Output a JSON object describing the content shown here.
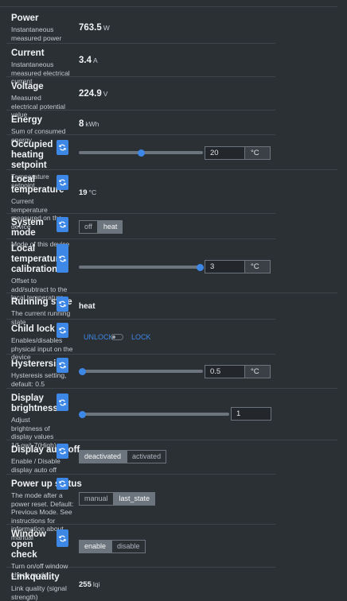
{
  "colors": {
    "background": "#2b3035",
    "accent": "#3d87e6",
    "border": "#3e444a"
  },
  "refresh_icon": "refresh-icon",
  "power": {
    "name": "Power",
    "desc": "Instantaneous measured power",
    "value": "763.5",
    "unit": "W"
  },
  "current": {
    "name": "Current",
    "desc": "Instantaneous measured electrical current",
    "value": "3.4",
    "unit": "A"
  },
  "voltage": {
    "name": "Voltage",
    "desc": "Measured electrical potential value",
    "value": "224.9",
    "unit": "V"
  },
  "energy": {
    "name": "Energy",
    "desc": "Sum of consumed energy",
    "value": "8",
    "unit": "kWh"
  },
  "setpoint": {
    "name": "Occupied heating setpoint",
    "desc": "Temperature setpoint",
    "value": "20",
    "unit": "°C",
    "slider_fraction": 0.5
  },
  "local_temp": {
    "name": "Local temperature",
    "desc": "Current temperature measured on the device",
    "value": "19",
    "unit": "°C"
  },
  "system_mode": {
    "name": "System mode",
    "desc": "Mode of this device",
    "options": [
      "off",
      "heat"
    ],
    "selected": "heat"
  },
  "calibration": {
    "name": "Local temperature calibration",
    "desc": "Offset to add/subtract to the local temperature",
    "value": "3",
    "unit": "°C",
    "slider_fraction": 1.0
  },
  "running_state": {
    "name": "Running state",
    "desc": "The current running state",
    "value": "heat"
  },
  "child_lock": {
    "name": "Child lock",
    "desc": "Enables/disables physical input on the device",
    "off_label": "UNLOCK",
    "on_label": "LOCK",
    "state": "UNLOCK"
  },
  "hysteresis": {
    "name": "Hysterersis",
    "desc": "Hysteresis setting, default: 0.5",
    "value": "0.5",
    "unit": "°C",
    "slider_fraction": 0.0
  },
  "brightness": {
    "name": "Display brightnesss",
    "desc": "Adjust brightness of display values 1(Low)-7(High)",
    "value": "1",
    "slider_fraction": 0.0
  },
  "auto_off": {
    "name": "Display auto off",
    "desc": "Enable / Disable display auto off",
    "options": [
      "deactivated",
      "activated"
    ],
    "selected": "deactivated"
  },
  "power_up": {
    "name": "Power up status",
    "desc": "The mode after a power reset. Default: Previous Mode. See instructions for information about manual",
    "options": [
      "manual",
      "last_state"
    ],
    "selected": "last_state"
  },
  "window_check": {
    "name": "Window open check",
    "desc": "Turn on/off window check mode",
    "options": [
      "enable",
      "disable"
    ],
    "selected": "enable"
  },
  "linkquality": {
    "name": "Linkquality",
    "desc": "Link quality (signal strength)",
    "value": "255",
    "unit": "lqi"
  }
}
